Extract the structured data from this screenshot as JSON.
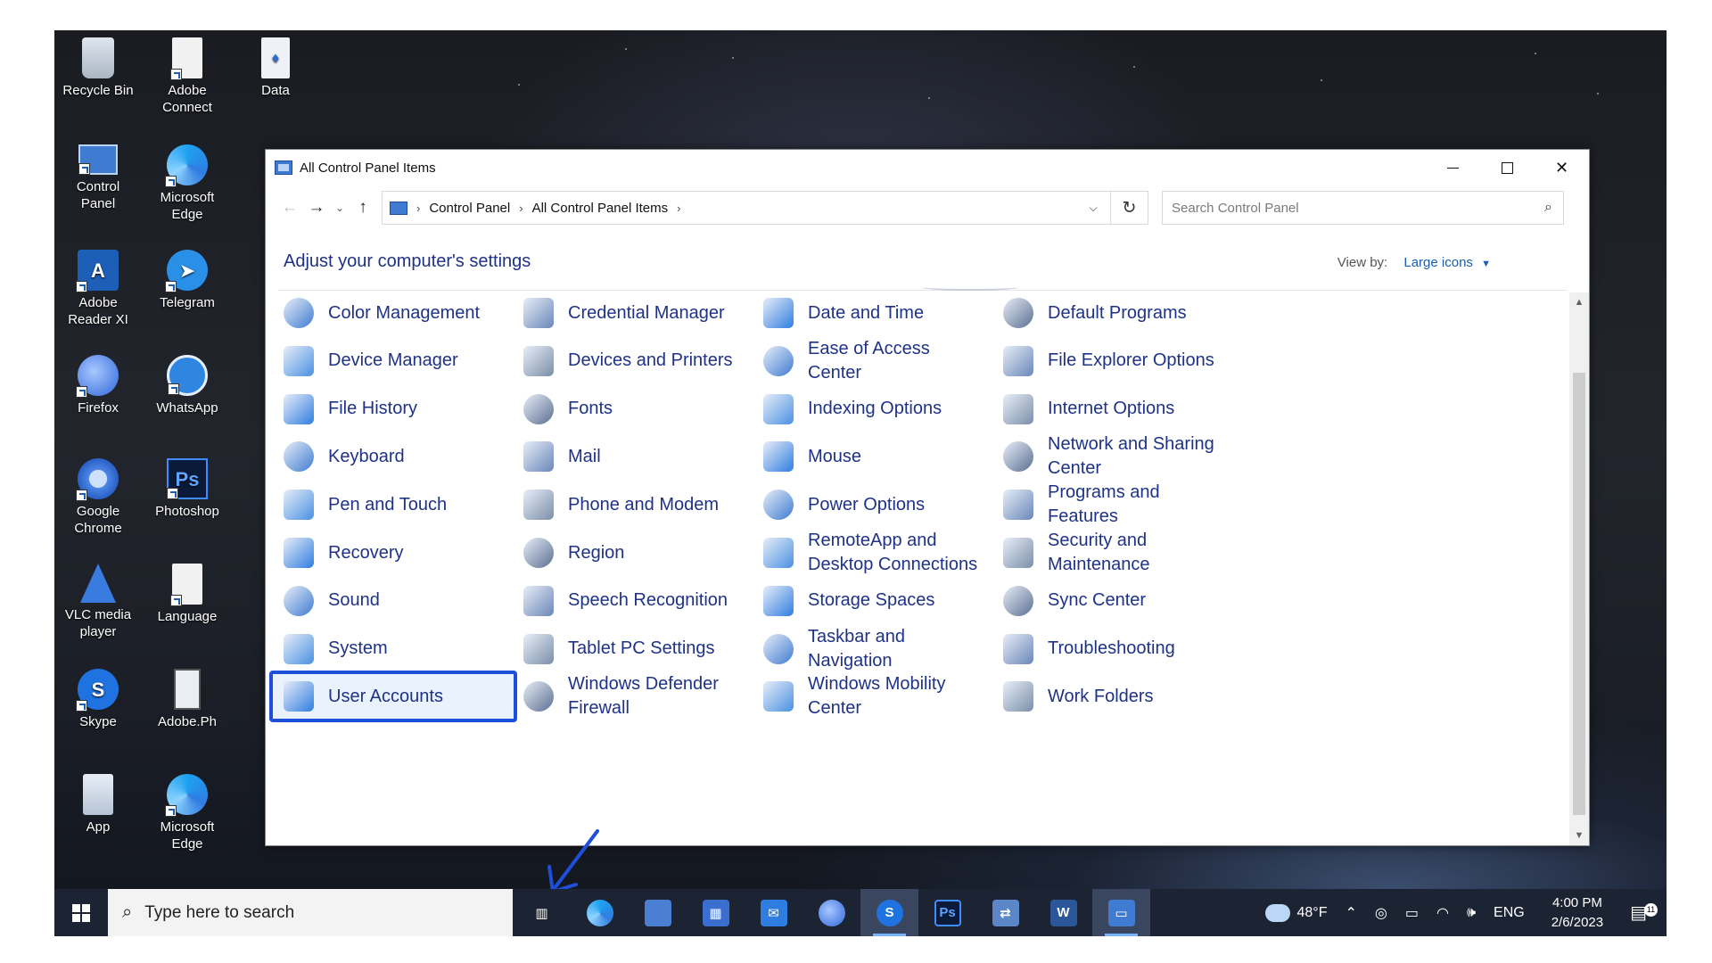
{
  "desktop": {
    "icons": [
      {
        "label": "Recycle Bin",
        "icon": "recycle-bin-icon"
      },
      {
        "label": "Adobe Connect",
        "icon": "adobe-connect-icon"
      },
      {
        "label": "Data",
        "icon": "data-file-icon"
      },
      {
        "label": "Control Panel",
        "icon": "control-panel-icon"
      },
      {
        "label": "Microsoft Edge",
        "icon": "edge-icon"
      },
      {
        "label": "Adobe Reader XI",
        "icon": "adobe-reader-icon"
      },
      {
        "label": "Telegram",
        "icon": "telegram-icon"
      },
      {
        "label": "Firefox",
        "icon": "firefox-icon"
      },
      {
        "label": "WhatsApp",
        "icon": "whatsapp-icon"
      },
      {
        "label": "Google Chrome",
        "icon": "chrome-icon"
      },
      {
        "label": "Photoshop",
        "icon": "photoshop-icon"
      },
      {
        "label": "VLC media player",
        "icon": "vlc-icon"
      },
      {
        "label": "Language",
        "icon": "language-icon"
      },
      {
        "label": "Skype",
        "icon": "skype-icon"
      },
      {
        "label": "Adobe.Ph",
        "icon": "adobe-ph-icon"
      },
      {
        "label": "App",
        "icon": "app-icon"
      },
      {
        "label": "Microsoft Edge",
        "icon": "edge-icon"
      }
    ],
    "icon_colors": {
      "blue": "#2f7de1",
      "red": "#e8572a"
    }
  },
  "window": {
    "title": "All Control Panel Items",
    "breadcrumb": [
      "Control Panel",
      "All Control Panel Items"
    ],
    "search_placeholder": "Search Control Panel",
    "heading": "Adjust your computer's settings",
    "view_by_label": "View by:",
    "view_by_value": "Large icons",
    "link_color": "#1e3287",
    "items": [
      {
        "label": "Color Management",
        "icon": "color-management-icon"
      },
      {
        "label": "Credential Manager",
        "icon": "credential-manager-icon"
      },
      {
        "label": "Date and Time",
        "icon": "date-time-icon"
      },
      {
        "label": "Default Programs",
        "icon": "default-programs-icon"
      },
      {
        "label": "Device Manager",
        "icon": "device-manager-icon"
      },
      {
        "label": "Devices and Printers",
        "icon": "printer-icon"
      },
      {
        "label": "Ease of Access Center",
        "icon": "ease-of-access-icon"
      },
      {
        "label": "File Explorer Options",
        "icon": "folder-options-icon"
      },
      {
        "label": "File History",
        "icon": "file-history-icon"
      },
      {
        "label": "Fonts",
        "icon": "fonts-icon"
      },
      {
        "label": "Indexing Options",
        "icon": "indexing-icon"
      },
      {
        "label": "Internet Options",
        "icon": "internet-options-icon"
      },
      {
        "label": "Keyboard",
        "icon": "keyboard-icon"
      },
      {
        "label": "Mail",
        "icon": "mail-icon"
      },
      {
        "label": "Mouse",
        "icon": "mouse-icon"
      },
      {
        "label": "Network and Sharing Center",
        "icon": "network-icon"
      },
      {
        "label": "Pen and Touch",
        "icon": "pen-icon"
      },
      {
        "label": "Phone and Modem",
        "icon": "phone-modem-icon"
      },
      {
        "label": "Power Options",
        "icon": "power-options-icon"
      },
      {
        "label": "Programs and Features",
        "icon": "programs-features-icon"
      },
      {
        "label": "Recovery",
        "icon": "recovery-icon"
      },
      {
        "label": "Region",
        "icon": "region-icon"
      },
      {
        "label": "RemoteApp and Desktop Connections",
        "icon": "remoteapp-icon"
      },
      {
        "label": "Security and Maintenance",
        "icon": "security-flag-icon"
      },
      {
        "label": "Sound",
        "icon": "sound-icon"
      },
      {
        "label": "Speech Recognition",
        "icon": "microphone-icon"
      },
      {
        "label": "Storage Spaces",
        "icon": "storage-spaces-icon"
      },
      {
        "label": "Sync Center",
        "icon": "sync-center-icon"
      },
      {
        "label": "System",
        "icon": "system-icon"
      },
      {
        "label": "Tablet PC Settings",
        "icon": "tablet-icon"
      },
      {
        "label": "Taskbar and Navigation",
        "icon": "taskbar-icon"
      },
      {
        "label": "Troubleshooting",
        "icon": "troubleshooting-icon"
      },
      {
        "label": "User Accounts",
        "icon": "user-accounts-icon",
        "selected": true
      },
      {
        "label": "Windows Defender Firewall",
        "icon": "firewall-icon"
      },
      {
        "label": "Windows Mobility Center",
        "icon": "mobility-center-icon"
      },
      {
        "label": "Work Folders",
        "icon": "work-folders-icon"
      }
    ]
  },
  "taskbar": {
    "search_placeholder": "Type here to search",
    "apps": [
      "task-view-icon",
      "edge-icon",
      "file-explorer-icon",
      "store-icon",
      "mail-icon",
      "firefox-icon",
      "skype-icon",
      "photoshop-icon",
      "network-app-icon",
      "word-icon",
      "control-panel-icon"
    ],
    "active_apps": [
      "skype-icon",
      "control-panel-icon"
    ],
    "temperature": "48°F",
    "language": "ENG",
    "time": "4:00 PM",
    "date": "2/6/2023",
    "notification_count": "11"
  }
}
